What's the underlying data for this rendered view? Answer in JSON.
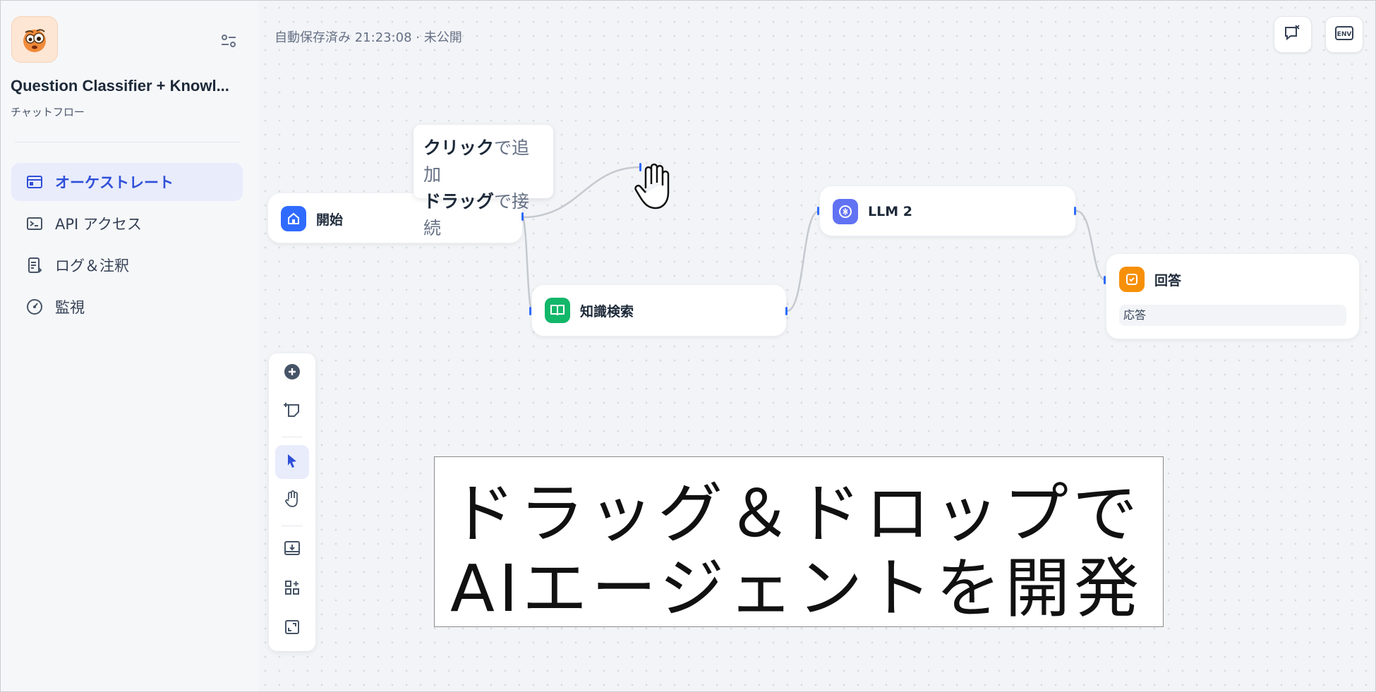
{
  "app": {
    "name": "Question Classifier + Knowl...",
    "type": "チャットフロー"
  },
  "nav": {
    "items": [
      {
        "label": "オーケストレート",
        "icon": "orchestrate-icon",
        "active": true
      },
      {
        "label": "API アクセス",
        "icon": "terminal-icon",
        "active": false
      },
      {
        "label": "ログ＆注釈",
        "icon": "log-icon",
        "active": false
      },
      {
        "label": "監視",
        "icon": "monitor-gauge-icon",
        "active": false
      }
    ]
  },
  "header": {
    "autosave": "自動保存済み 21:23:08 · 未公開"
  },
  "tooltip": {
    "line1_bold": "クリック",
    "line1_rest": "で追加",
    "line2_bold": "ドラッグ",
    "line2_rest": "で接続"
  },
  "nodes": {
    "start": {
      "title": "開始",
      "color": "#2f6bff"
    },
    "knowledge": {
      "title": "知識検索",
      "color": "#12b76a"
    },
    "llm": {
      "title": "LLM 2",
      "color": "#6172f3"
    },
    "answer": {
      "title": "回答",
      "field": "応答",
      "color": "#f79009"
    }
  },
  "toolbar": {
    "tools": [
      "add-node-icon",
      "add-note-icon",
      "pointer-icon",
      "hand-icon",
      "export-image-icon",
      "organize-icon",
      "fit-view-icon"
    ],
    "active": "pointer-icon"
  },
  "caption": {
    "line1": "ドラッグ＆ドロップで",
    "line2": "AIエージェントを開発"
  },
  "colors": {
    "accent": "#2f4fd8",
    "handle": "#2f6bff",
    "edge": "#c5c9d0"
  }
}
